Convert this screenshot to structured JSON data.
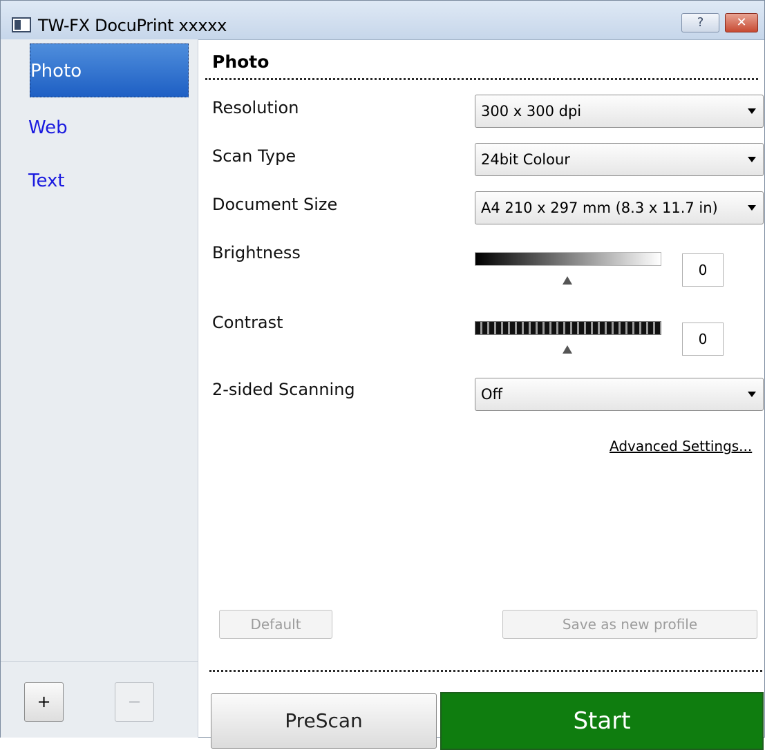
{
  "window": {
    "title": "TW-FX DocuPrint xxxxx",
    "help_label": "?",
    "close_label": "✕"
  },
  "sidebar": {
    "items": [
      {
        "label": "Photo",
        "selected": true
      },
      {
        "label": "Web",
        "selected": false
      },
      {
        "label": "Text",
        "selected": false
      }
    ],
    "add_label": "+",
    "remove_label": "−"
  },
  "main": {
    "title": "Photo",
    "resolution": {
      "label": "Resolution",
      "value": "300 x 300 dpi"
    },
    "scan_type": {
      "label": "Scan Type",
      "value": "24bit Colour"
    },
    "document_size": {
      "label": "Document Size",
      "value": "A4 210 x 297 mm (8.3 x 11.7 in)"
    },
    "brightness": {
      "label": "Brightness",
      "value": "0"
    },
    "contrast": {
      "label": "Contrast",
      "value": "0"
    },
    "two_sided": {
      "label": "2-sided Scanning",
      "value": "Off"
    },
    "advanced_link": "Advanced Settings...",
    "default_button": "Default",
    "save_profile_button": "Save as new profile",
    "prescan_button": "PreScan",
    "start_button": "Start"
  },
  "colors": {
    "start_green": "#0f7d0f",
    "selected_blue": "#2f6fd0",
    "link_blue": "#1a1adf"
  }
}
